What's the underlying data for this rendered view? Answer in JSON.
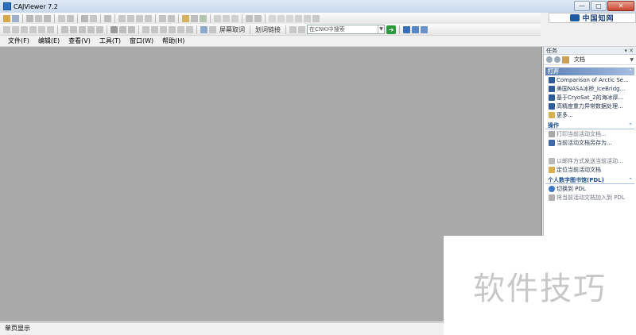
{
  "window": {
    "title": "CAJViewer 7.2"
  },
  "window_buttons": {
    "minimize": "—",
    "maximize": "□",
    "close": "✕"
  },
  "brand": {
    "text": "中国知网"
  },
  "toolbar2": {
    "fullscreen_cancel": "屏幕取词",
    "dict_link": "划词链接",
    "search_placeholder": "在CNKI中搜索"
  },
  "menu": [
    "文件(F)",
    "编辑(E)",
    "查看(V)",
    "工具(T)",
    "窗口(W)",
    "帮助(H)"
  ],
  "taskpane": {
    "title": "任务",
    "controls": "▾ ✕",
    "doc_selector": "文档",
    "sections": {
      "open": {
        "title": "打开",
        "items": [
          "Comparison of Arctic Se...",
          "美国NASA冰桥_IceBridg...",
          "基于CryoSat_2的海冰厚...",
          "高精度重力异常数据处理...",
          "更多..."
        ]
      },
      "ops": {
        "title": "操作",
        "items": [
          "打印当前活动文档...",
          "当前活动文档另存为...",
          "以邮件方式发送当前活动...",
          "定位当前活动文档"
        ]
      },
      "pdl": {
        "title": "个人数字图书馆(PDL)",
        "items": [
          "切换到 PDL",
          "将当前活动文档加入到 PDL"
        ]
      }
    }
  },
  "status": {
    "text": "单页显示"
  },
  "watermark": {
    "text": "软件技巧"
  },
  "colors": {
    "doc_bg": "#a9a9a9",
    "section_head": "#5d82b8",
    "brand": "#1b3f7a"
  }
}
